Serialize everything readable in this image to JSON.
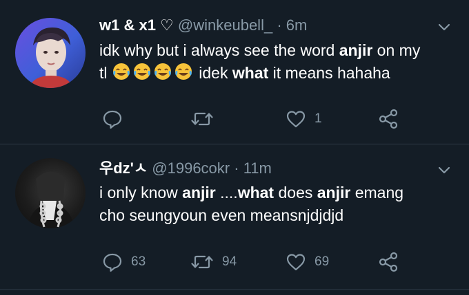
{
  "tweets": [
    {
      "display_name": "w1 & x1 ♡",
      "handle": "@winkeubell_",
      "separator": "·",
      "time": "6m",
      "text_line1_parts": [
        "idk why but i always see the word ",
        "anjir",
        " on my"
      ],
      "text_line2_parts": [
        "tl ",
        " idek ",
        "what",
        " it means hahaha"
      ],
      "emojis": [
        "face-with-tears-of-joy",
        "face-with-tears-of-joy",
        "face-with-tears-of-joy",
        "face-with-tears-of-joy"
      ],
      "actions": {
        "reply_count": "",
        "retweet_count": "",
        "like_count": "1"
      }
    },
    {
      "display_name": "우dz'ㅅ",
      "handle": "@1996cokr",
      "separator": "·",
      "time": "11m",
      "text_line1_parts": [
        "i only know ",
        "anjir",
        " ....",
        "what",
        " does ",
        "anjir",
        " emang"
      ],
      "text_line2": "cho seungyoun even meansnjdjdjd",
      "actions": {
        "reply_count": "63",
        "retweet_count": "94",
        "like_count": "69"
      }
    }
  ],
  "colors": {
    "background": "#141d26",
    "text_primary": "#ffffff",
    "text_secondary": "#8899a6",
    "divider": "#2f3b47"
  },
  "icons": [
    "reply-icon",
    "retweet-icon",
    "like-icon",
    "share-icon",
    "chevron-down-icon",
    "face-with-tears-of-joy"
  ]
}
